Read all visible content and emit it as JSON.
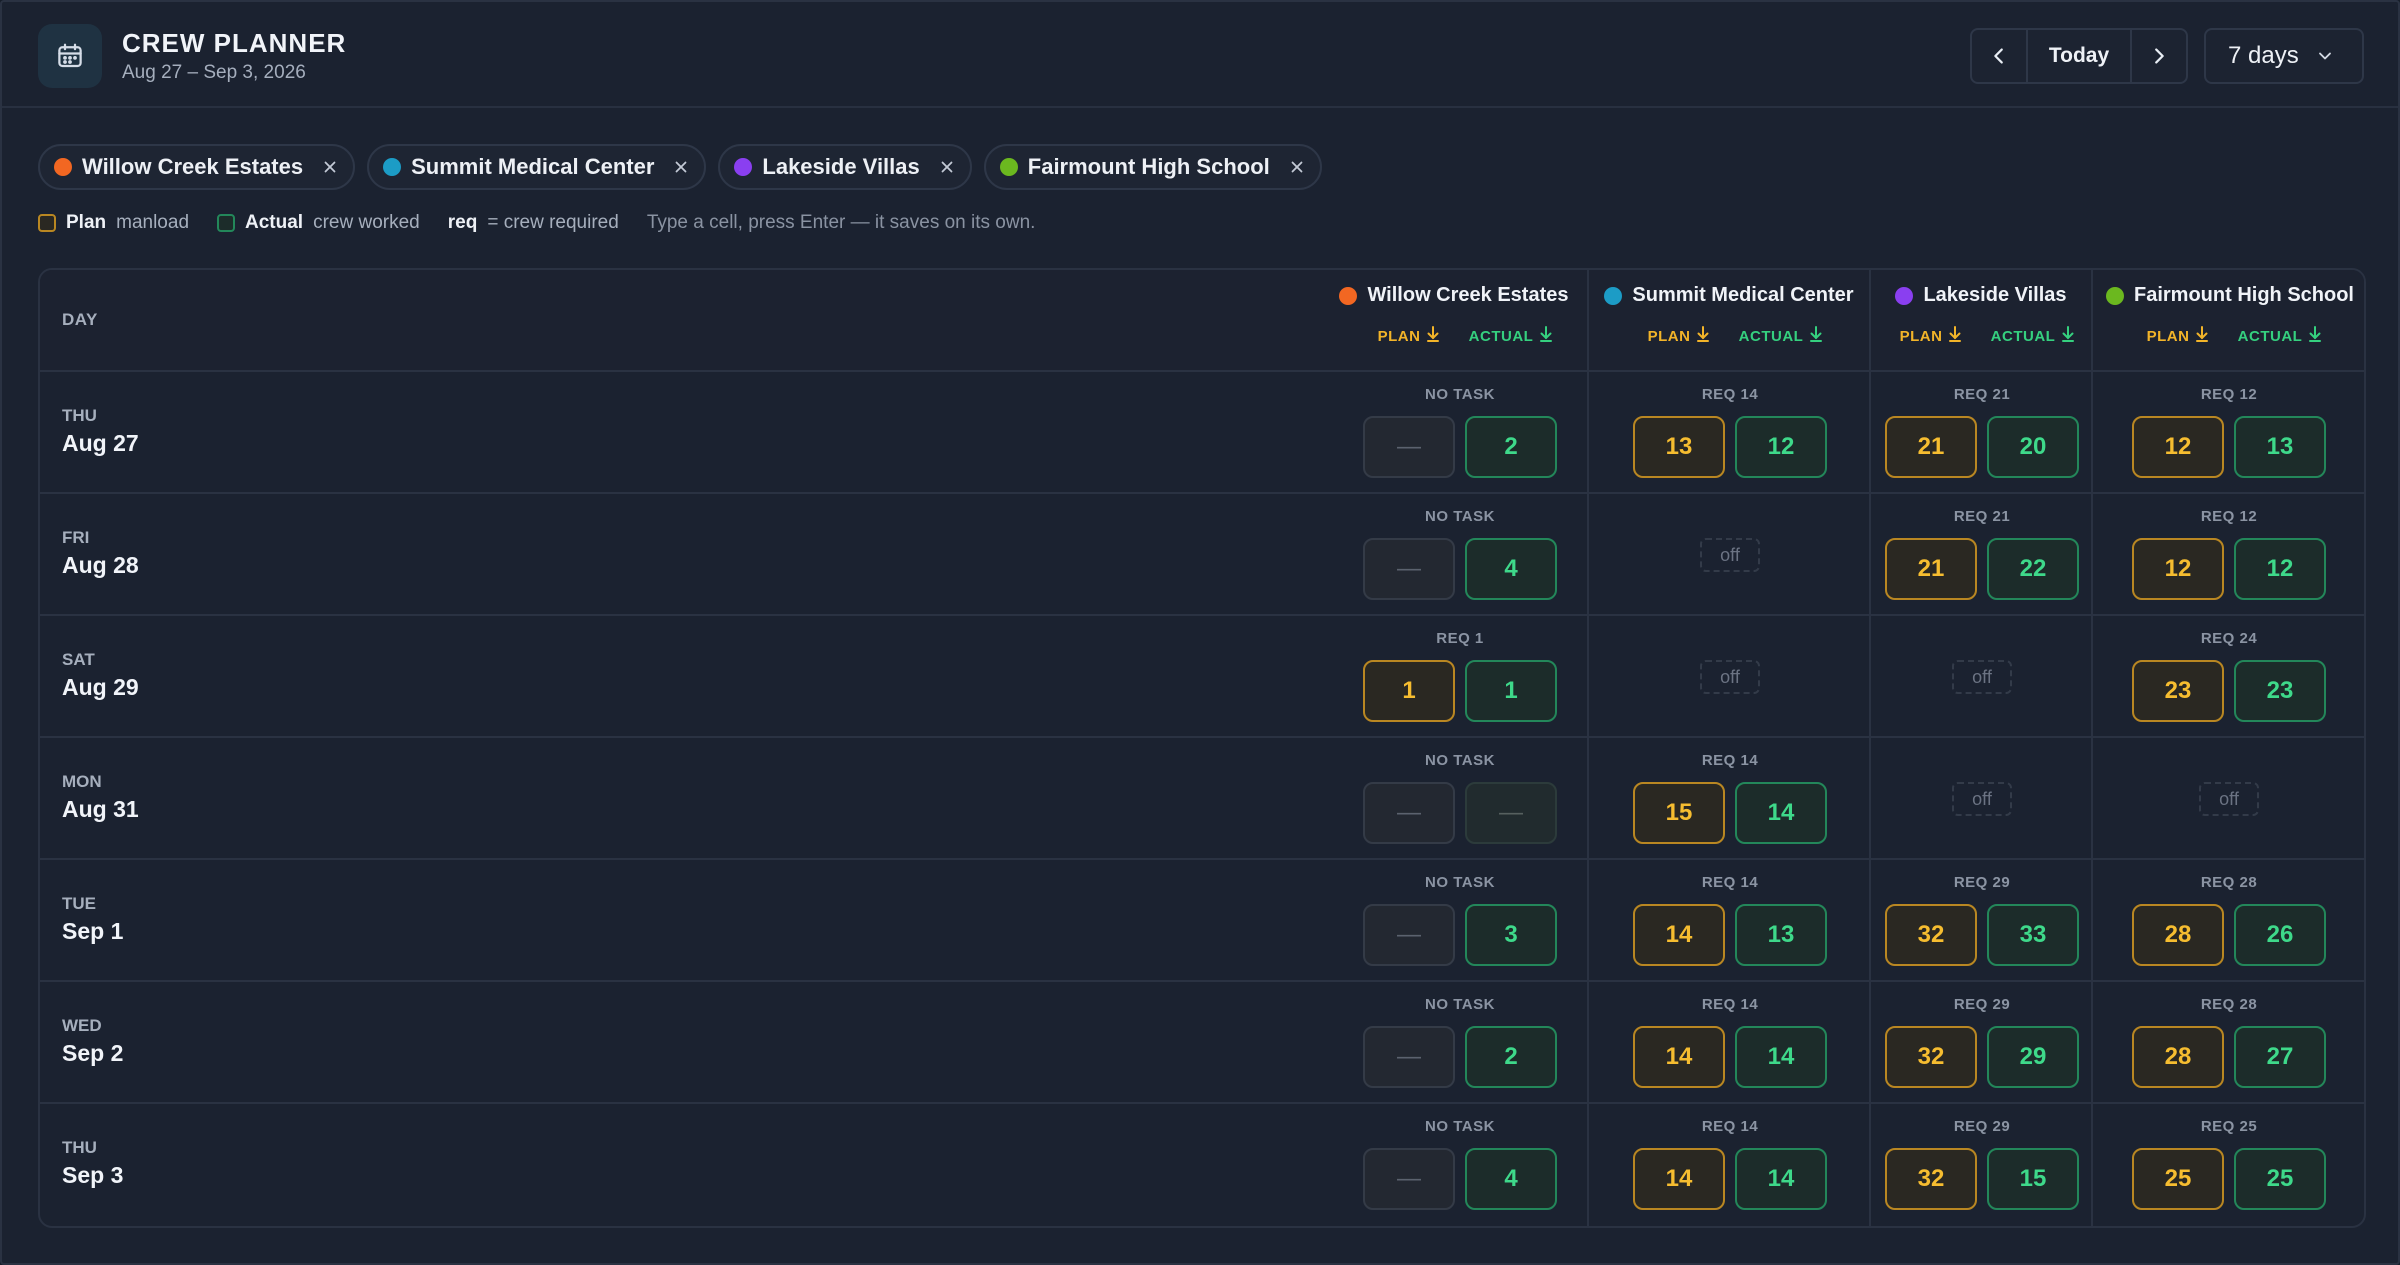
{
  "header": {
    "title": "CREW PLANNER",
    "subtitle": "Aug 27 – Sep 3, 2026",
    "today_label": "Today",
    "range_value": "7 days",
    "icons": {
      "calendar": "calendar-icon",
      "prev": "chevron-left-icon",
      "next": "chevron-right-icon",
      "dropdown": "chevron-down-icon"
    }
  },
  "sites": [
    {
      "name": "Willow Creek Estates",
      "color": "#f26722"
    },
    {
      "name": "Summit Medical Center",
      "color": "#1c9cc6"
    },
    {
      "name": "Lakeside Villas",
      "color": "#8a3ff0"
    },
    {
      "name": "Fairmount High School",
      "color": "#6bb81f"
    }
  ],
  "legend": {
    "plan_label": "Plan",
    "plan_desc": "manload",
    "actual_label": "Actual",
    "actual_desc": "crew worked",
    "req_label": "req",
    "req_desc": "= crew required",
    "hint": "Type a cell, press Enter — it saves on its own."
  },
  "table": {
    "day_header": "DAY",
    "plan_header": "PLAN",
    "actual_header": "ACTUAL",
    "no_task_label": "NO TASK",
    "off_label": "off",
    "empty_value": "—",
    "rows": [
      {
        "dow": "THU",
        "date": "Aug 27",
        "cells": [
          {
            "type": "task",
            "req": "NO TASK",
            "plan": "—",
            "actual": "2"
          },
          {
            "type": "task",
            "req": "REQ 14",
            "plan": "13",
            "actual": "12"
          },
          {
            "type": "task",
            "req": "REQ 21",
            "plan": "21",
            "actual": "20"
          },
          {
            "type": "task",
            "req": "REQ 12",
            "plan": "12",
            "actual": "13"
          }
        ]
      },
      {
        "dow": "FRI",
        "date": "Aug 28",
        "cells": [
          {
            "type": "task",
            "req": "NO TASK",
            "plan": "—",
            "actual": "4"
          },
          {
            "type": "off"
          },
          {
            "type": "task",
            "req": "REQ 21",
            "plan": "21",
            "actual": "22"
          },
          {
            "type": "task",
            "req": "REQ 12",
            "plan": "12",
            "actual": "12"
          }
        ]
      },
      {
        "dow": "SAT",
        "date": "Aug 29",
        "cells": [
          {
            "type": "task",
            "req": "REQ 1",
            "plan": "1",
            "actual": "1"
          },
          {
            "type": "off"
          },
          {
            "type": "off"
          },
          {
            "type": "task",
            "req": "REQ 24",
            "plan": "23",
            "actual": "23"
          }
        ]
      },
      {
        "dow": "MON",
        "date": "Aug 31",
        "cells": [
          {
            "type": "task",
            "req": "NO TASK",
            "plan": "—",
            "actual": "—"
          },
          {
            "type": "task",
            "req": "REQ 14",
            "plan": "15",
            "actual": "14"
          },
          {
            "type": "off"
          },
          {
            "type": "off"
          }
        ]
      },
      {
        "dow": "TUE",
        "date": "Sep 1",
        "cells": [
          {
            "type": "task",
            "req": "NO TASK",
            "plan": "—",
            "actual": "3"
          },
          {
            "type": "task",
            "req": "REQ 14",
            "plan": "14",
            "actual": "13"
          },
          {
            "type": "task",
            "req": "REQ 29",
            "plan": "32",
            "actual": "33"
          },
          {
            "type": "task",
            "req": "REQ 28",
            "plan": "28",
            "actual": "26"
          }
        ]
      },
      {
        "dow": "WED",
        "date": "Sep 2",
        "cells": [
          {
            "type": "task",
            "req": "NO TASK",
            "plan": "—",
            "actual": "2"
          },
          {
            "type": "task",
            "req": "REQ 14",
            "plan": "14",
            "actual": "14"
          },
          {
            "type": "task",
            "req": "REQ 29",
            "plan": "32",
            "actual": "29"
          },
          {
            "type": "task",
            "req": "REQ 28",
            "plan": "28",
            "actual": "27"
          }
        ]
      },
      {
        "dow": "THU",
        "date": "Sep 3",
        "cells": [
          {
            "type": "task",
            "req": "NO TASK",
            "plan": "—",
            "actual": "4"
          },
          {
            "type": "task",
            "req": "REQ 14",
            "plan": "14",
            "actual": "14"
          },
          {
            "type": "task",
            "req": "REQ 29",
            "plan": "32",
            "actual": "15"
          },
          {
            "type": "task",
            "req": "REQ 25",
            "plan": "25",
            "actual": "25"
          }
        ]
      }
    ]
  },
  "colors": {
    "plan_accent": "#f2b429",
    "actual_accent": "#35d07f",
    "background": "#1b2230"
  }
}
